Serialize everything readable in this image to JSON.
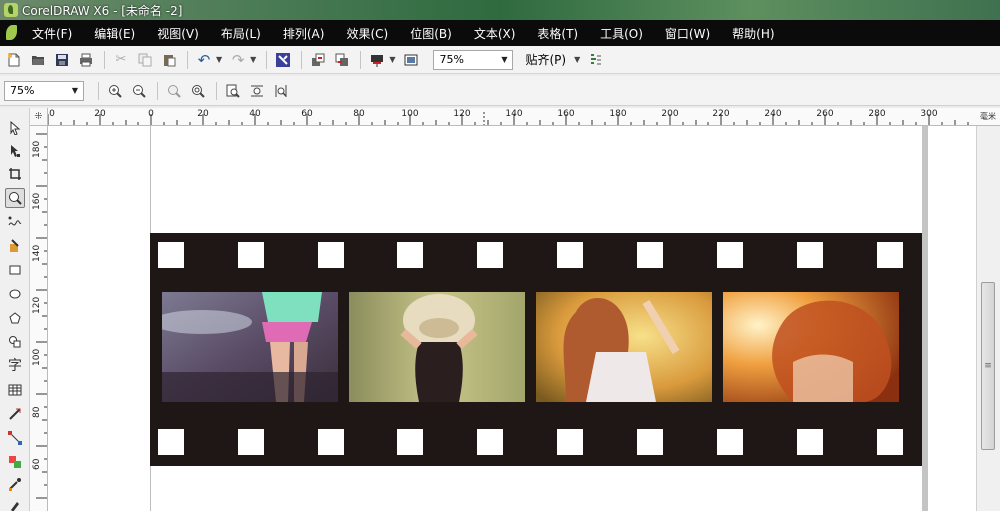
{
  "window": {
    "title": "CorelDRAW X6 - [未命名 -2]"
  },
  "menu": [
    "文件(F)",
    "编辑(E)",
    "视图(V)",
    "布局(L)",
    "排列(A)",
    "效果(C)",
    "位图(B)",
    "文本(X)",
    "表格(T)",
    "工具(O)",
    "窗口(W)",
    "帮助(H)"
  ],
  "toolbar": {
    "zoom_value": "75%",
    "snap_label": "贴齐(P)"
  },
  "zoom_toolbar": {
    "zoom_value": "75%"
  },
  "rulers": {
    "horizontal": [
      "0",
      "20",
      "0",
      "20",
      "40",
      "60",
      "80",
      "100",
      "120",
      "140",
      "160",
      "180",
      "200",
      "220",
      "240",
      "260",
      "280",
      "300"
    ],
    "vertical": [
      "180",
      "160",
      "140",
      "120",
      "100",
      "80",
      "60"
    ],
    "unit": "毫米"
  },
  "tools": [
    "pick-tool-icon",
    "shape-tool-icon",
    "crop-tool-icon",
    "zoom-tool-icon",
    "freehand-tool-icon",
    "smart-fill-icon",
    "rectangle-tool-icon",
    "ellipse-tool-icon",
    "polygon-tool-icon",
    "basic-shapes-icon",
    "text-tool-icon",
    "table-tool-icon",
    "dimension-tool-icon",
    "connector-tool-icon",
    "effects-tool-icon",
    "eyedropper-icon",
    "outline-pen-icon"
  ],
  "text_tool_glyph": "字",
  "colors": {
    "film": "#1f1715",
    "menubar": "#0b0b0b",
    "photo1": "#6a5a6e",
    "photo2": "#a9a56a",
    "photo3": "#e0a046",
    "photo4": "#e27a28"
  }
}
